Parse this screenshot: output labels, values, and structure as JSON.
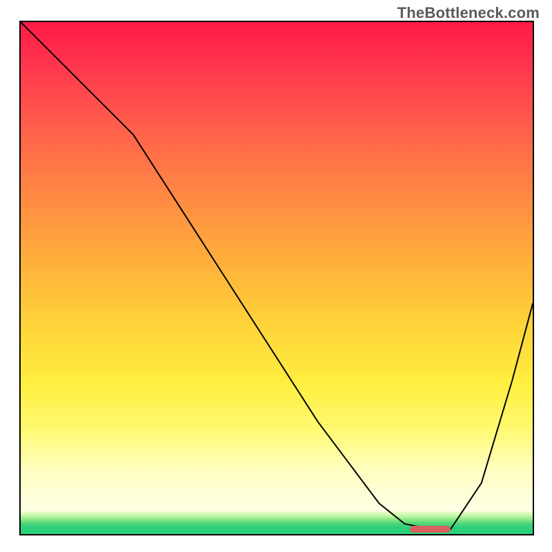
{
  "watermark": "TheBottleneck.com",
  "chart_data": {
    "type": "line",
    "title": "",
    "xlabel": "",
    "ylabel": "",
    "xlim": [
      0,
      100
    ],
    "ylim": [
      0,
      100
    ],
    "grid": false,
    "legend": false,
    "series": [
      {
        "name": "curve",
        "x": [
          0,
          10,
          22,
          40,
          58,
          70,
          75,
          80,
          84,
          90,
          96,
          100
        ],
        "y": [
          100,
          90,
          78,
          50,
          22,
          6,
          2,
          1,
          1,
          10,
          30,
          45
        ]
      }
    ],
    "marker": {
      "x_start": 76,
      "x_end": 84,
      "y": 1
    },
    "background_gradient_stops": [
      {
        "pos": 0,
        "color": "#ff1a46"
      },
      {
        "pos": 25,
        "color": "#ff6a4a"
      },
      {
        "pos": 52,
        "color": "#ffb83a"
      },
      {
        "pos": 74,
        "color": "#ffef40"
      },
      {
        "pos": 92,
        "color": "#ffffc4"
      },
      {
        "pos": 96,
        "color": "#c7f8a9"
      },
      {
        "pos": 100,
        "color": "#29d07b"
      }
    ]
  }
}
